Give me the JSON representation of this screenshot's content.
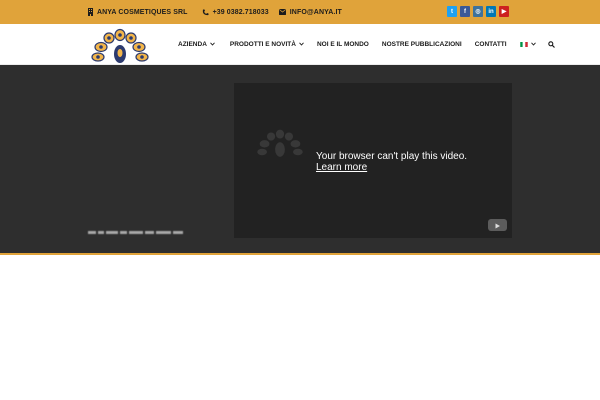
{
  "topbar": {
    "company": "ANYA COSMETIQUES SRL",
    "phone": "+39 0382.718033",
    "email": "INFO@ANYA.IT",
    "background": "#e0a33a",
    "social": [
      {
        "name": "twitter",
        "glyph": "t",
        "color": "#1da1f2"
      },
      {
        "name": "facebook",
        "glyph": "f",
        "color": "#3b5998"
      },
      {
        "name": "instagram",
        "glyph": "◎",
        "color": "#3f729b"
      },
      {
        "name": "linkedin",
        "glyph": "in",
        "color": "#0077b5"
      },
      {
        "name": "youtube",
        "glyph": "▶",
        "color": "#cd201f"
      }
    ]
  },
  "nav": {
    "items": [
      {
        "label": "AZIENDA",
        "dropdown": true
      },
      {
        "label": "PRODOTTI E NOVITÀ",
        "dropdown": true
      },
      {
        "label": "NOI E IL MONDO",
        "dropdown": false
      },
      {
        "label": "NOSTRE PUBBLICAZIONI",
        "dropdown": false
      },
      {
        "label": "CONTATTI",
        "dropdown": false
      }
    ],
    "language": "it-flag-icon",
    "search": "search-icon"
  },
  "hero": {
    "video_message": "Your browser can't play this video.",
    "learn_more": "Learn more",
    "background": "#2e2e2e"
  }
}
